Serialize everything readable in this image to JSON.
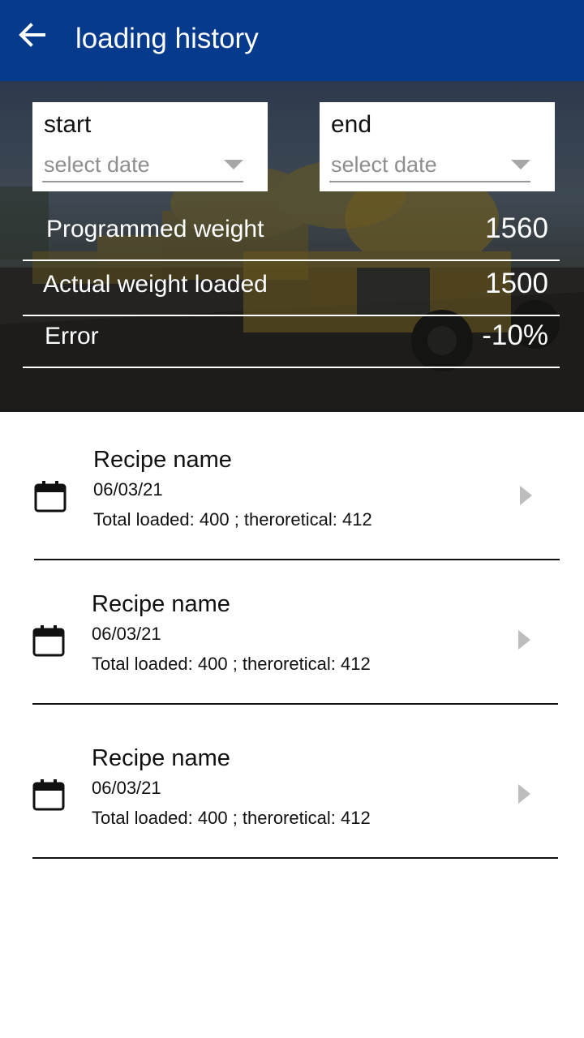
{
  "app_bar": {
    "title": "loading history",
    "background": "#063a8c",
    "back_icon": "arrow-left-icon"
  },
  "filters": {
    "start": {
      "label": "start",
      "placeholder": "select date"
    },
    "end": {
      "label": "end",
      "placeholder": "select date"
    }
  },
  "summary": [
    {
      "label": "Programmed weight",
      "value": "1560"
    },
    {
      "label": "Actual weight loaded",
      "value": "1500"
    },
    {
      "label": "Error",
      "value": "-10%"
    }
  ],
  "history": [
    {
      "name": "Recipe name",
      "date": "06/03/21",
      "detail": "Total loaded: 400 ; theroretical: 412",
      "icon": "calendar-icon"
    },
    {
      "name": "Recipe name",
      "date": "06/03/21",
      "detail": "Total loaded: 400 ; theroretical: 412",
      "icon": "calendar-icon"
    },
    {
      "name": "Recipe name",
      "date": "06/03/21",
      "detail": "Total loaded: 400 ; theroretical: 412",
      "icon": "calendar-icon"
    }
  ]
}
